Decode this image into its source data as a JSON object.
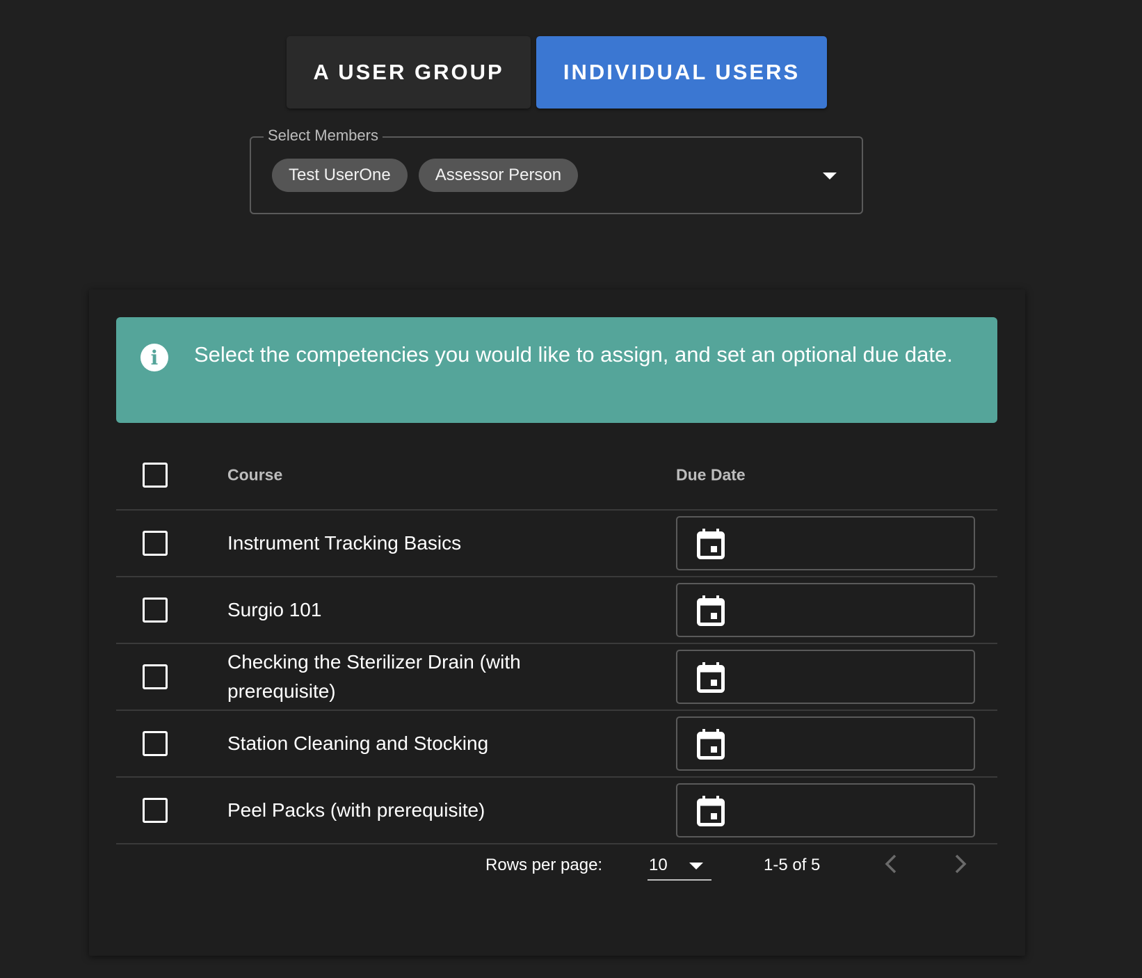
{
  "toggle": {
    "group_label": "A USER GROUP",
    "individual_label": "INDIVIDUAL USERS",
    "active": "individual"
  },
  "members": {
    "legend": "Select Members",
    "chips": [
      "Test UserOne",
      "Assessor Person"
    ]
  },
  "info": {
    "message": "Select the competencies you would like to assign, and set an optional due date."
  },
  "table": {
    "columns": {
      "course": "Course",
      "due_date": "Due Date"
    },
    "rows": [
      {
        "course": "Instrument Tracking Basics",
        "due_date": ""
      },
      {
        "course": "Surgio 101",
        "due_date": ""
      },
      {
        "course": "Checking the Sterilizer Drain (with prerequisite)",
        "due_date": ""
      },
      {
        "course": "Station Cleaning and Stocking",
        "due_date": ""
      },
      {
        "course": "Peel Packs (with prerequisite)",
        "due_date": ""
      }
    ]
  },
  "pagination": {
    "rows_per_page_label": "Rows per page:",
    "rows_per_page_value": "10",
    "range": "1-5 of 5"
  },
  "icons": {
    "info": "info-icon",
    "calendar": "calendar-icon",
    "prev": "chevron-left-icon",
    "next": "chevron-right-icon",
    "dropdown": "caret-down-icon"
  },
  "colors": {
    "background": "#202020",
    "primary": "#3b77d2",
    "info": "#55a59a",
    "chip": "#555555"
  }
}
